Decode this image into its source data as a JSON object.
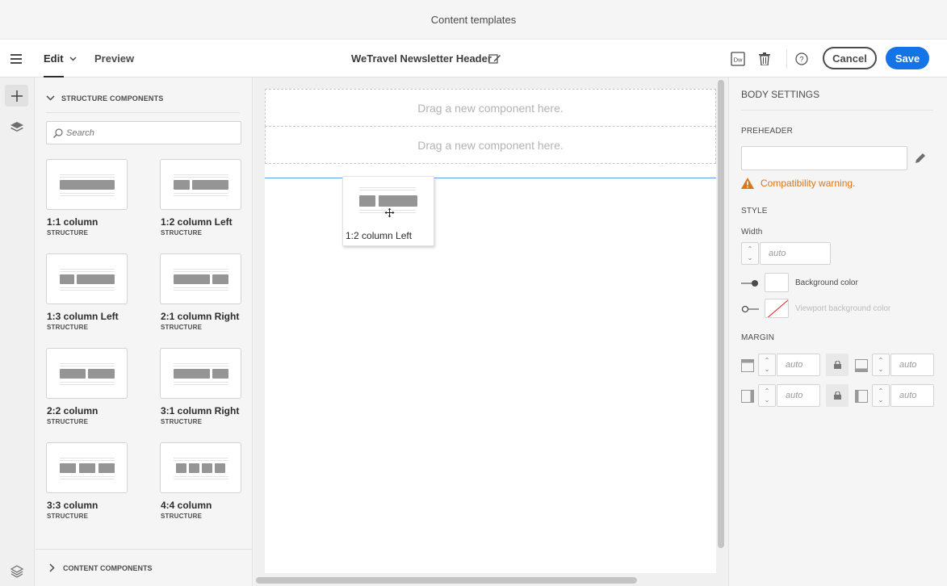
{
  "window": {
    "title": "Content templates"
  },
  "toolbar": {
    "edit_label": "Edit",
    "preview_label": "Preview",
    "template_title": "WeTravel Newsletter Header",
    "dw_label": "Dw",
    "cancel_label": "Cancel",
    "save_label": "Save"
  },
  "panel": {
    "structure_heading": "STRUCTURE COMPONENTS",
    "search_placeholder": "Search",
    "components": [
      {
        "name": "1:1 column",
        "type": "STRUCTURE"
      },
      {
        "name": "1:2 column Left",
        "type": "STRUCTURE"
      },
      {
        "name": "1:3 column Left",
        "type": "STRUCTURE"
      },
      {
        "name": "2:1 column Right",
        "type": "STRUCTURE"
      },
      {
        "name": "2:2 column",
        "type": "STRUCTURE"
      },
      {
        "name": "3:1 column Right",
        "type": "STRUCTURE"
      },
      {
        "name": "3:3 column",
        "type": "STRUCTURE"
      },
      {
        "name": "4:4 column",
        "type": "STRUCTURE"
      }
    ],
    "content_heading": "CONTENT COMPONENTS"
  },
  "canvas": {
    "dropzone_1": "Drag a new component here.",
    "dropzone_2": "Drag a new component here.",
    "drag_ghost_label": "1:2 column Left"
  },
  "settings": {
    "heading": "BODY SETTINGS",
    "preheader_label": "PREHEADER",
    "preheader_value": "",
    "warning": "Compatibility warning.",
    "style_label": "STYLE",
    "width_label": "Width",
    "width_value": "auto",
    "background_color_label": "Background color",
    "viewport_color_label": "Viewport background color",
    "margin_label": "MARGIN",
    "margin_top": "auto",
    "margin_bottom": "auto",
    "margin_left": "auto",
    "margin_right": "auto"
  },
  "colors": {
    "accent": "#1473e6",
    "warning": "#d7761b"
  }
}
